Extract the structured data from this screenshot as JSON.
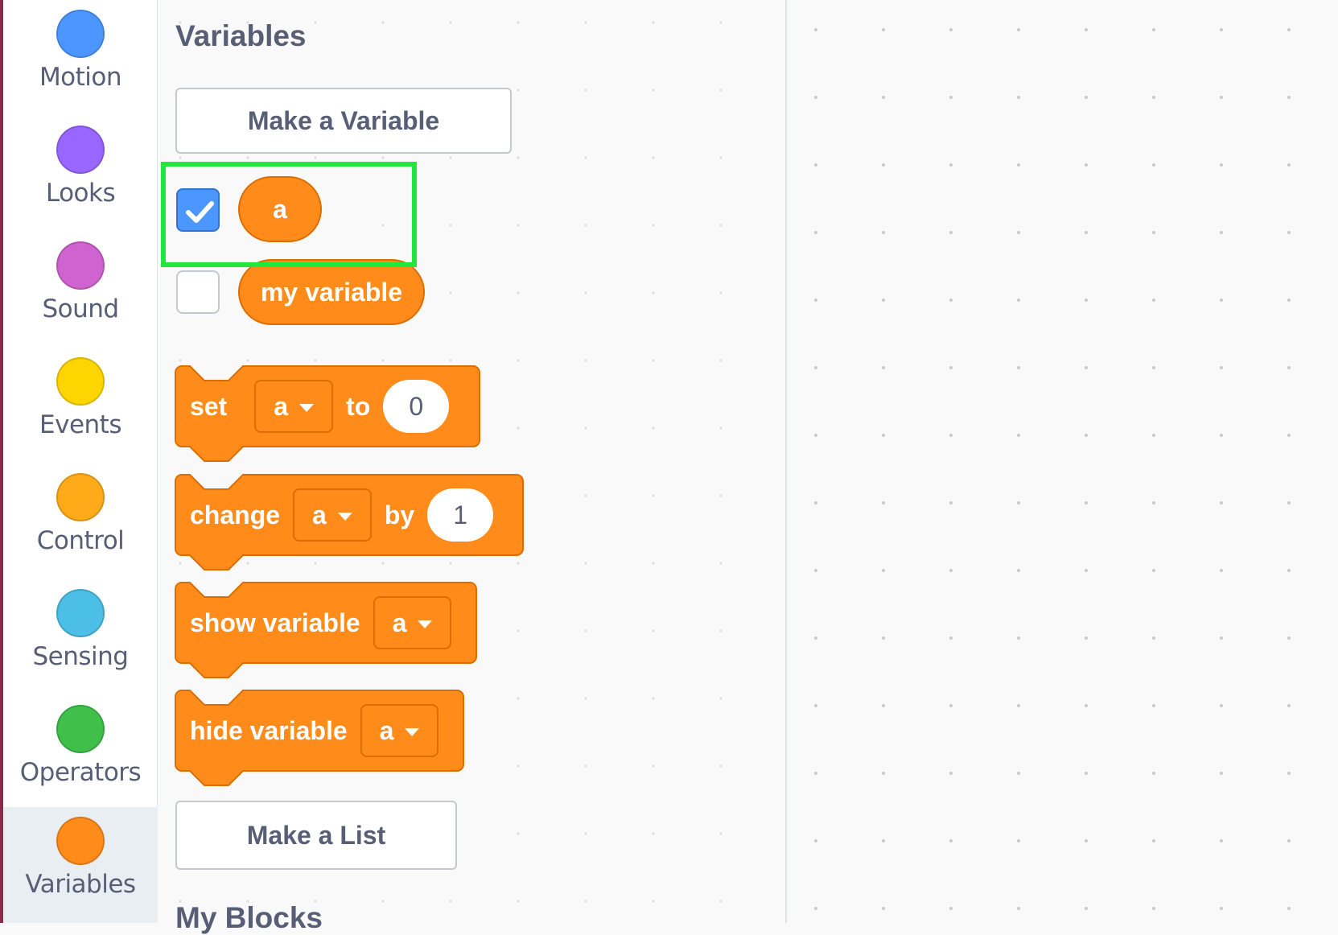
{
  "categories": [
    {
      "label": "Motion",
      "color": "#4c97ff",
      "selected": false
    },
    {
      "label": "Looks",
      "color": "#9966ff",
      "selected": false
    },
    {
      "label": "Sound",
      "color": "#cf63cf",
      "selected": false
    },
    {
      "label": "Events",
      "color": "#ffd500",
      "selected": false
    },
    {
      "label": "Control",
      "color": "#ffab19",
      "selected": false
    },
    {
      "label": "Sensing",
      "color": "#4cbfe6",
      "selected": false
    },
    {
      "label": "Operators",
      "color": "#40bf4a",
      "selected": false
    },
    {
      "label": "Variables",
      "color": "#ff8c1a",
      "selected": true
    }
  ],
  "flyout": {
    "heading": "Variables",
    "make_variable_label": "Make a Variable",
    "variables": [
      {
        "name": "a",
        "checked": true
      },
      {
        "name": "my variable",
        "checked": false
      }
    ],
    "blocks": {
      "set": {
        "label": "set",
        "var": "a",
        "to_label": "to",
        "value": "0"
      },
      "change": {
        "label": "change",
        "var": "a",
        "by_label": "by",
        "value": "1"
      },
      "show": {
        "label": "show variable",
        "var": "a"
      },
      "hide": {
        "label": "hide variable",
        "var": "a"
      }
    },
    "make_list_label": "Make a List",
    "next_heading": "My Blocks"
  },
  "colors": {
    "variables_block": "#ff8c1a",
    "variables_border": "#db6e00",
    "highlight": "#22e63c",
    "checkbox_checked": "#4c97ff"
  },
  "icons": {
    "checkmark": "checkmark-icon",
    "dropdown": "dropdown-caret-icon"
  }
}
